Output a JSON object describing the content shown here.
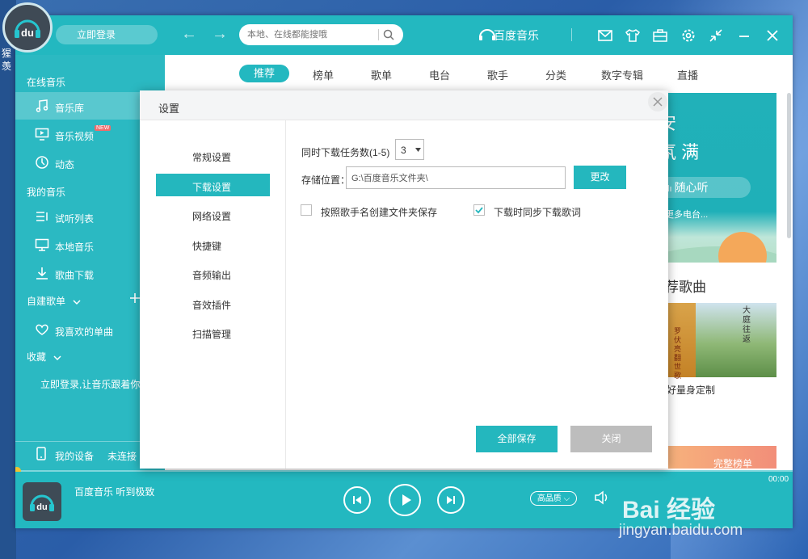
{
  "app": {
    "brand": "百度音乐",
    "login_label": "立即登录",
    "search_placeholder": "本地、在线都能搜哦"
  },
  "desktop": {
    "side_text": "猩 羡"
  },
  "tabs": [
    "推荐",
    "榜单",
    "歌单",
    "电台",
    "歌手",
    "分类",
    "数字专辑",
    "直播"
  ],
  "sidebar": {
    "section_online": "在线音乐",
    "music_library": "音乐库",
    "music_video": "音乐视频",
    "new_badge": "NEW",
    "feed": "动态",
    "section_mine": "我的音乐",
    "trial_list": "试听列表",
    "local_music": "本地音乐",
    "downloads": "歌曲下载",
    "section_custom": "自建歌单",
    "favorites": "我喜欢的单曲",
    "section_collect": "收藏",
    "login_hint": "立即登录,让音乐跟着你走",
    "my_device": "我的设备",
    "not_connected": "未连接"
  },
  "content": {
    "banner_line1": "安",
    "banner_line2": "氛 满",
    "banner_button": "随心听",
    "banner_more": "更多电台...",
    "rec_title": "荐歌曲",
    "rec_caption": "好量身定制",
    "rec_img_text": "罗伏亮翻世歌",
    "rec_img2_text": "大庭往返",
    "rec_bar": "完整榜单"
  },
  "player": {
    "song": "百度音乐 听到极致",
    "quality": "高品质",
    "time": "00:00"
  },
  "dialog": {
    "title": "设置",
    "menu": [
      "常规设置",
      "下载设置",
      "网络设置",
      "快捷键",
      "音频输出",
      "音效插件",
      "扫描管理"
    ],
    "active_index": 1,
    "concurrent_label": "同时下载任务数(1-5)",
    "concurrent_value": "3",
    "path_label": "存储位置：",
    "path_value": "G:\\百度音乐文件夹\\",
    "change_button": "更改",
    "option_folder": "按照歌手名创建文件夹保存",
    "option_folder_checked": false,
    "option_lyrics": "下载时同步下载歌词",
    "option_lyrics_checked": true,
    "save_all": "全部保存",
    "close": "关闭"
  },
  "watermark": {
    "brand": "Bai 经验",
    "url": "jingyan.baidu.com"
  },
  "colors": {
    "accent": "#23b8c0",
    "button_grey": "#bdbdbd"
  }
}
